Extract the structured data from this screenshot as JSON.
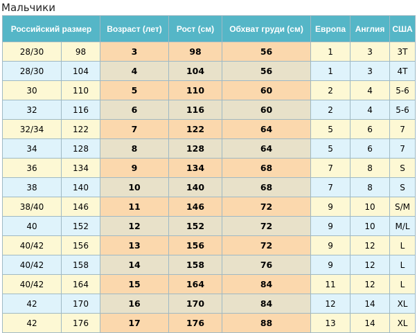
{
  "title": "Мальчики",
  "table": {
    "headers": [
      "Российский размер",
      "Возраст (лет)",
      "Рост (см)",
      "Обхват груди (см)",
      "Европа",
      "Англия",
      "США"
    ],
    "rows": [
      [
        "28/30",
        "98",
        "3",
        "98",
        "56",
        "1",
        "3",
        "3T"
      ],
      [
        "28/30",
        "104",
        "4",
        "104",
        "56",
        "1",
        "3",
        "4T"
      ],
      [
        "30",
        "110",
        "5",
        "110",
        "60",
        "2",
        "4",
        "5-6"
      ],
      [
        "32",
        "116",
        "6",
        "116",
        "60",
        "2",
        "4",
        "5-6"
      ],
      [
        "32/34",
        "122",
        "7",
        "122",
        "64",
        "5",
        "6",
        "7"
      ],
      [
        "34",
        "128",
        "8",
        "128",
        "64",
        "5",
        "6",
        "7"
      ],
      [
        "36",
        "134",
        "9",
        "134",
        "68",
        "7",
        "8",
        "S"
      ],
      [
        "38",
        "140",
        "10",
        "140",
        "68",
        "7",
        "8",
        "S"
      ],
      [
        "38/40",
        "146",
        "11",
        "146",
        "72",
        "9",
        "10",
        "S/M"
      ],
      [
        "40",
        "152",
        "12",
        "152",
        "72",
        "9",
        "10",
        "M/L"
      ],
      [
        "40/42",
        "156",
        "13",
        "156",
        "72",
        "9",
        "12",
        "L"
      ],
      [
        "40/42",
        "158",
        "14",
        "158",
        "76",
        "9",
        "12",
        "L"
      ],
      [
        "40/42",
        "164",
        "15",
        "164",
        "84",
        "11",
        "12",
        "L"
      ],
      [
        "42",
        "170",
        "16",
        "170",
        "84",
        "12",
        "14",
        "XL"
      ],
      [
        "42",
        "176",
        "17",
        "176",
        "88",
        "13",
        "14",
        "XL"
      ]
    ]
  },
  "colors": {
    "header_bg": "#55b6c7",
    "row_odd": "#fdf8d4",
    "row_even": "#dff3fb",
    "highlight_odd": "#fbd8ad",
    "highlight_even": "#e8e1c9"
  }
}
